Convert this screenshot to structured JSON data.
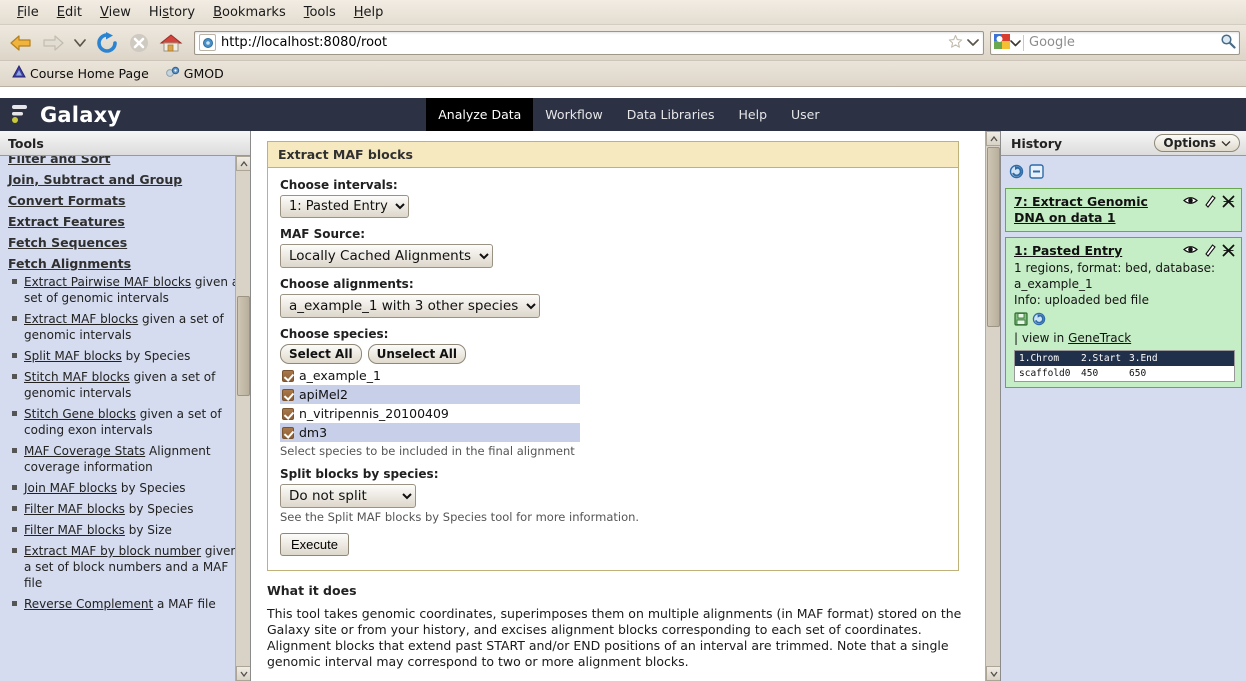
{
  "browser": {
    "menus": [
      "File",
      "Edit",
      "View",
      "History",
      "Bookmarks",
      "Tools",
      "Help"
    ],
    "url": "http://localhost:8080/root",
    "search_placeholder": "Google",
    "bookmarks": [
      {
        "label": "Course Home Page",
        "icon": "triangle-favicon"
      },
      {
        "label": "GMOD",
        "icon": "gear-favicon"
      }
    ],
    "icons": {
      "back": "back-arrow-icon",
      "forward": "forward-arrow-icon",
      "dropdown": "history-dropdown-icon",
      "reload": "reload-icon",
      "stop": "stop-icon",
      "home": "home-icon",
      "star": "bookmark-star-icon",
      "go_search": "search-magnifier-icon"
    }
  },
  "galaxy": {
    "brand": "Galaxy",
    "nav": [
      {
        "label": "Analyze Data",
        "active": true
      },
      {
        "label": "Workflow",
        "active": false
      },
      {
        "label": "Data Libraries",
        "active": false
      },
      {
        "label": "Help",
        "active": false
      },
      {
        "label": "User",
        "active": false
      }
    ]
  },
  "tools": {
    "panel_title": "Tools",
    "sections": [
      {
        "label": "Filter and Sort",
        "items": []
      },
      {
        "label": "Join, Subtract and Group",
        "items": []
      },
      {
        "label": "Convert Formats",
        "items": []
      },
      {
        "label": "Extract Features",
        "items": []
      },
      {
        "label": "Fetch Sequences",
        "items": []
      },
      {
        "label": "Fetch Alignments",
        "items": [
          {
            "link": "Extract Pairwise MAF blocks",
            "desc": "given a set of genomic intervals"
          },
          {
            "link": "Extract MAF blocks",
            "desc": "given a set of genomic intervals"
          },
          {
            "link": "Split MAF blocks",
            "desc": "by Species"
          },
          {
            "link": "Stitch MAF blocks",
            "desc": "given a set of genomic intervals"
          },
          {
            "link": "Stitch Gene blocks",
            "desc": "given a set of coding exon intervals"
          },
          {
            "link": "MAF Coverage Stats",
            "desc": "Alignment coverage information"
          },
          {
            "link": "Join MAF blocks",
            "desc": "by Species"
          },
          {
            "link": "Filter MAF blocks",
            "desc": "by Species"
          },
          {
            "link": "Filter MAF blocks",
            "desc": "by Size"
          },
          {
            "link": "Extract MAF by block number",
            "desc": "given a set of block numbers and a MAF file"
          },
          {
            "link": "Reverse Complement",
            "desc": "a MAF file"
          }
        ]
      }
    ]
  },
  "form": {
    "title": "Extract MAF blocks",
    "fields": {
      "intervals_label": "Choose intervals:",
      "intervals_value": "1: Pasted Entry",
      "maf_source_label": "MAF Source:",
      "maf_source_value": "Locally Cached Alignments",
      "alignments_label": "Choose alignments:",
      "alignments_value": "a_example_1 with 3 other species",
      "species_label": "Choose species:",
      "select_all": "Select All",
      "unselect_all": "Unselect All",
      "species": [
        {
          "name": "a_example_1",
          "checked": true
        },
        {
          "name": "apiMel2",
          "checked": true
        },
        {
          "name": "n_vitripennis_20100409",
          "checked": true
        },
        {
          "name": "dm3",
          "checked": true
        }
      ],
      "species_help": "Select species to be included in the final alignment",
      "split_label": "Split blocks by species:",
      "split_value": "Do not split",
      "split_help": "See the Split MAF blocks by Species tool for more information.",
      "execute": "Execute"
    }
  },
  "widget": {
    "title": "What it does",
    "body": "This tool takes genomic coordinates, superimposes them on multiple alignments (in MAF format) stored on the Galaxy site or from your history, and excises alignment blocks corresponding to each set of coordinates. Alignment blocks that extend past START and/or END positions of an interval are trimmed. Note that a single genomic interval may correspond to two or more alignment blocks."
  },
  "history": {
    "panel_title": "History",
    "options_label": "Options",
    "items": [
      {
        "name": "7: Extract Genomic DNA on data 1",
        "body": "",
        "info": "",
        "links_prefix": "",
        "link": "",
        "peek": null
      },
      {
        "name": "1: Pasted Entry",
        "body": "1 regions, format: bed, database: a_example_1",
        "info": "Info: uploaded bed file",
        "links_prefix": "| view in",
        "link": "GeneTrack",
        "peek": {
          "headers": [
            "1.Chrom",
            "2.Start",
            "3.End"
          ],
          "rows": [
            [
              "scaffold0",
              "450",
              "650"
            ]
          ]
        }
      }
    ],
    "icons": {
      "display": "eye-icon",
      "edit": "pencil-icon",
      "delete": "delete-x-icon",
      "refresh": "refresh-icon",
      "collapse": "collapse-icon",
      "save": "save-disk-icon",
      "rerun": "rerun-icon"
    }
  },
  "colors": {
    "masthead": "#2c3143",
    "form_header": "#f6e8bf",
    "form_border": "#bfb17a",
    "panel_bg": "#d5dcef",
    "history_ok": "#c6eec6",
    "history_ok_border": "#6aa84f"
  }
}
